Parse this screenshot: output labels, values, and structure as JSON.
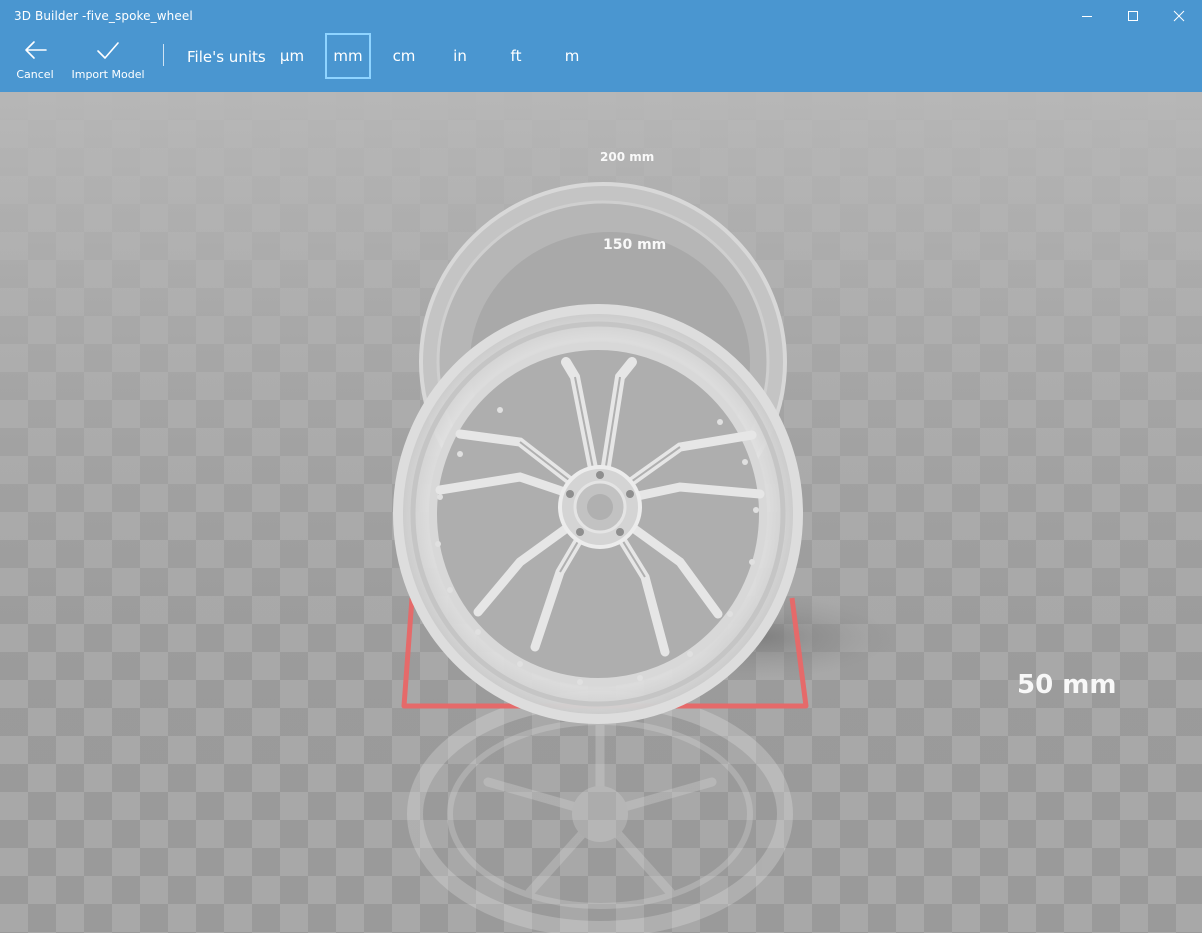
{
  "window": {
    "title": "3D Builder -five_spoke_wheel",
    "controls": [
      "minimize-icon",
      "maximize-icon",
      "close-icon"
    ]
  },
  "toolbar": {
    "cancel_label": "Cancel",
    "import_label": "Import Model",
    "units_label": "File's units",
    "units": [
      "µm",
      "mm",
      "cm",
      "in",
      "ft",
      "m"
    ],
    "selected_unit": "mm"
  },
  "viewport": {
    "ruler_labels": [
      "200 mm",
      "150 mm",
      "50 mm"
    ],
    "model": "wheel",
    "colors": {
      "selection_box": "#e56a6a",
      "toolbar": "#4a96d0"
    }
  }
}
